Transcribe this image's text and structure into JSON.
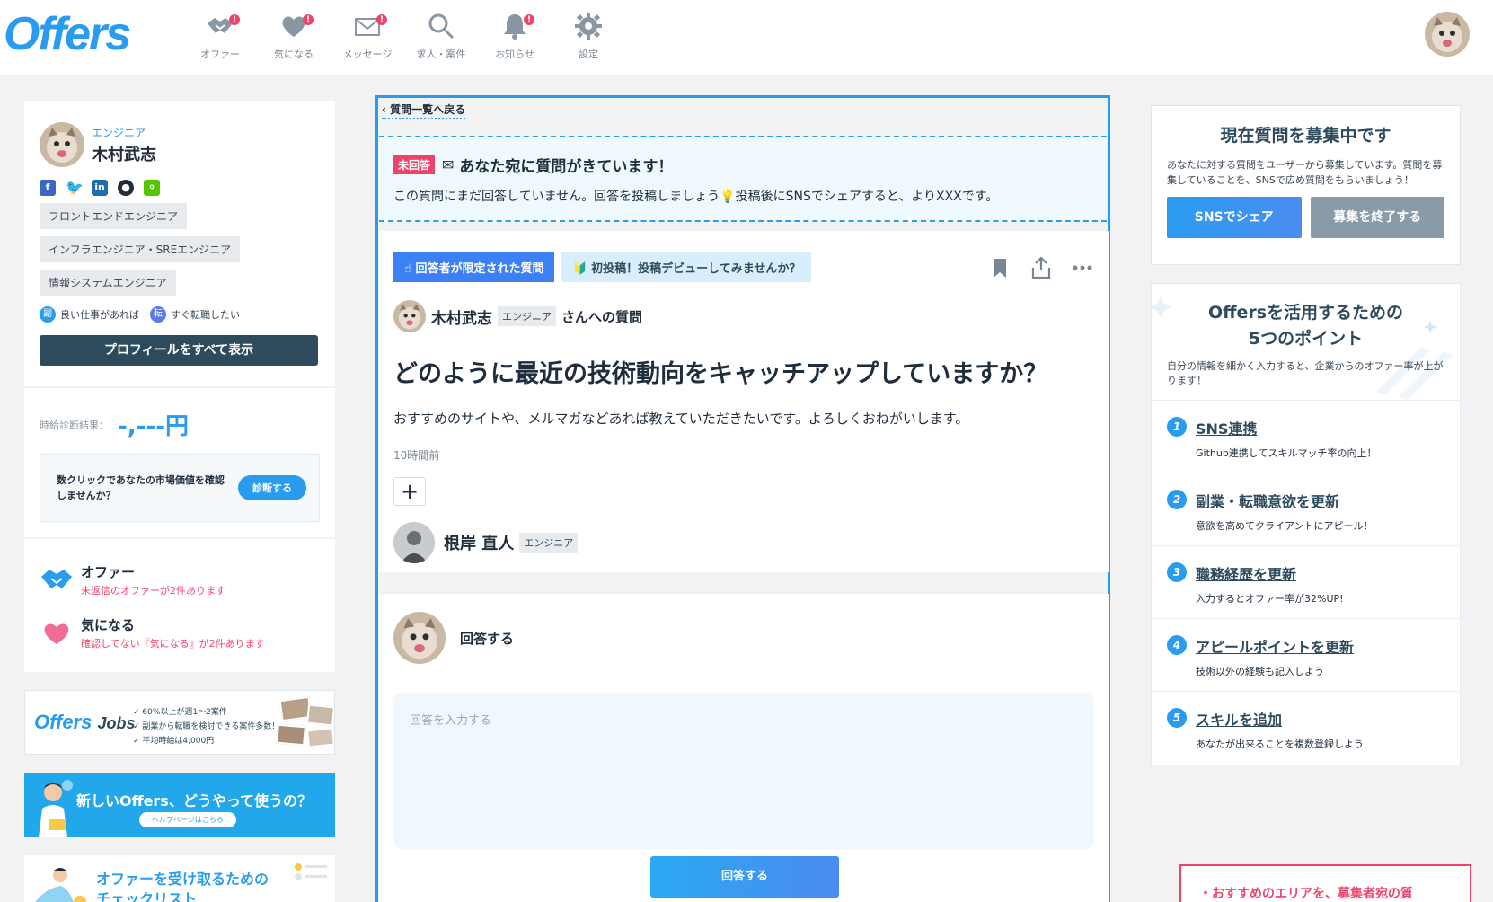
{
  "header": {
    "logo": "Offers",
    "nav": [
      {
        "label": "オファー",
        "icon": "handshake-icon",
        "badge": "!"
      },
      {
        "label": "気になる",
        "icon": "heart-icon",
        "badge": "!"
      },
      {
        "label": "メッセージ",
        "icon": "mail-icon",
        "badge": "!"
      },
      {
        "label": "求人・案件",
        "icon": "search-icon",
        "badge": ""
      },
      {
        "label": "お知らせ",
        "icon": "bell-icon",
        "badge": "!"
      },
      {
        "label": "設定",
        "icon": "gear-icon",
        "badge": ""
      }
    ]
  },
  "profile": {
    "role": "エンジニア",
    "name": "木村武志",
    "tags": [
      "フロントエンドエンジニア",
      "インフラエンジニア・SREエンジニア",
      "情報システムエンジニア"
    ],
    "intent_side_badge": "副",
    "intent_side": "良い仕事があれば",
    "intent_change_badge": "転",
    "intent_change": "すぐ転職したい",
    "show_all": "プロフィールをすべて表示"
  },
  "salary": {
    "label": "時給診断結果：",
    "value": "-,---円",
    "prompt": "数クリックであなたの市場価値を確認しませんか？",
    "button": "診断する"
  },
  "notifications": [
    {
      "title": "オファー",
      "sub": "未返信のオファーが2件あります",
      "icon": "handshake-icon"
    },
    {
      "title": "気になる",
      "sub": "確認してない『気になる』が2件あります",
      "icon": "heart-icon"
    }
  ],
  "banner_jobs": {
    "logo": "Offers",
    "logo_suffix": "Jobs",
    "items": [
      "✓ 60%以上が週1〜2案件",
      "✓ 副業から転職を検討できる案件多数！",
      "✓ 平均時給は4,000円！"
    ]
  },
  "banner_help": {
    "title": "新しいOffers、どうやって使うの？",
    "button": "ヘルプページはこちら"
  },
  "banner_check": {
    "title_line1": "オファーを受け取るための",
    "title_line2": "チェックリスト"
  },
  "question": {
    "back": "質問一覧へ戻る",
    "status": "未回答",
    "notice_title": "あなた宛に質問がきています！",
    "notice_body": "この質問にまだ回答していません。回答を投稿しましょう💡投稿後にSNSでシェアすると、よりXXXです。",
    "tag_limited": "☝ 回答者が限定された質問",
    "tag_first": "🔰 初投稿！投稿デビューしてみませんか？",
    "asker_name": "木村武志",
    "asker_role": "エンジニア",
    "asker_suffix": "さんへの質問",
    "title": "どのように最近の技術動向をキャッチアップしていますか？",
    "body": "おすすめのサイトや、メルマガなどあれば教えていただきたいです。よろしくおねがいします。",
    "time": "10時間前",
    "plus": "+",
    "target_name": "根岸 直人",
    "target_role": "エンジニア"
  },
  "answer": {
    "label": "回答する",
    "placeholder": "回答を入力する",
    "button": "回答する"
  },
  "recruit": {
    "title": "現在質問を募集中です",
    "desc": "あなたに対する質問をユーザーから募集しています。質問を募集していることを、SNSで広め質問をもらいましょう！",
    "share": "SNSでシェア",
    "end": "募集を終了する"
  },
  "points": {
    "title_line1": "Offersを活用するための",
    "title_line2": "5つのポイント",
    "desc": "自分の情報を細かく入力すると、企業からのオファー率が上がります！",
    "items": [
      {
        "num": "1",
        "title": "SNS連携",
        "sub": "Github連携してスキルマッチ率の向上！"
      },
      {
        "num": "2",
        "title": "副業・転職意欲を更新",
        "sub": "意欲を高めてクライアントにアピール！"
      },
      {
        "num": "3",
        "title": "職務経歴を更新",
        "sub": "入力するとオファー率が32%UP!"
      },
      {
        "num": "4",
        "title": "アピールポイントを更新",
        "sub": "技術以外の経験も記入しよう"
      },
      {
        "num": "5",
        "title": "スキルを追加",
        "sub": "あなたが出来ることを複数登録しよう"
      }
    ]
  },
  "tip": {
    "text": "・おすすめのエリアを、募集者宛の質"
  },
  "colors": {
    "brand": "#2a9cf0",
    "alert": "#f0436b",
    "dark_button": "#2d4b5c"
  }
}
